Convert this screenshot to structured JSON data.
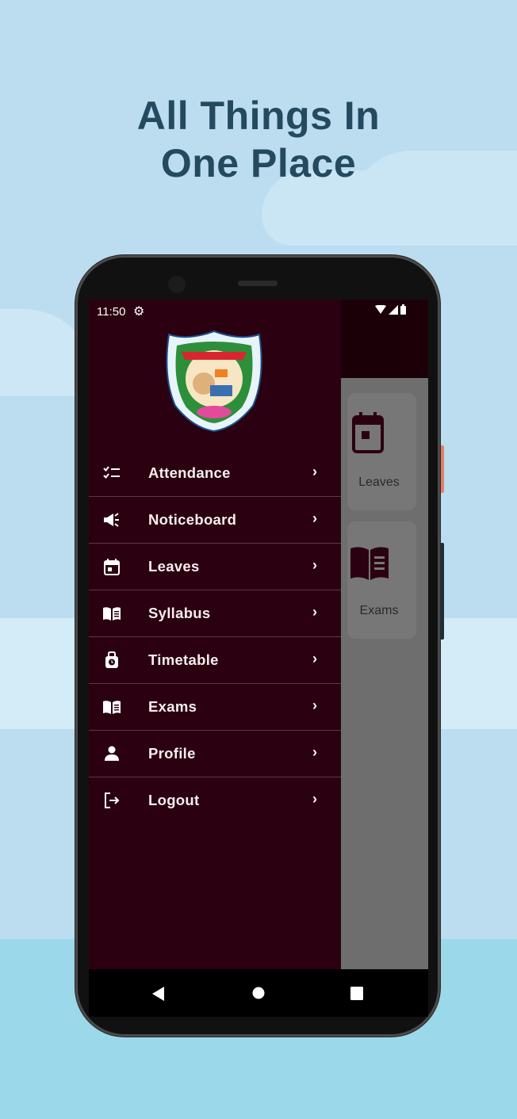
{
  "headline": {
    "line1": "All Things In",
    "line2": "One Place"
  },
  "statusbar": {
    "time": "11:50",
    "icons": [
      "gear-icon",
      "wifi-icon",
      "signal-icon",
      "battery-icon"
    ]
  },
  "drawer": {
    "logo": "school-crest-logo",
    "items": [
      {
        "label": "Attendance",
        "icon": "checklist-icon"
      },
      {
        "label": "Noticeboard",
        "icon": "megaphone-icon"
      },
      {
        "label": "Leaves",
        "icon": "calendar-icon"
      },
      {
        "label": "Syllabus",
        "icon": "book-icon"
      },
      {
        "label": "Timetable",
        "icon": "clock-bag-icon"
      },
      {
        "label": "Exams",
        "icon": "book-icon"
      },
      {
        "label": "Profile",
        "icon": "person-icon"
      },
      {
        "label": "Logout",
        "icon": "logout-icon"
      }
    ],
    "chevron": "›"
  },
  "background_cards": [
    {
      "label": "Leaves",
      "icon": "calendar-icon"
    },
    {
      "label": "Exams",
      "icon": "book-icon"
    }
  ],
  "colors": {
    "drawer_bg": "#2b0010",
    "headline": "#244a60",
    "background": "#bcdcf0"
  }
}
